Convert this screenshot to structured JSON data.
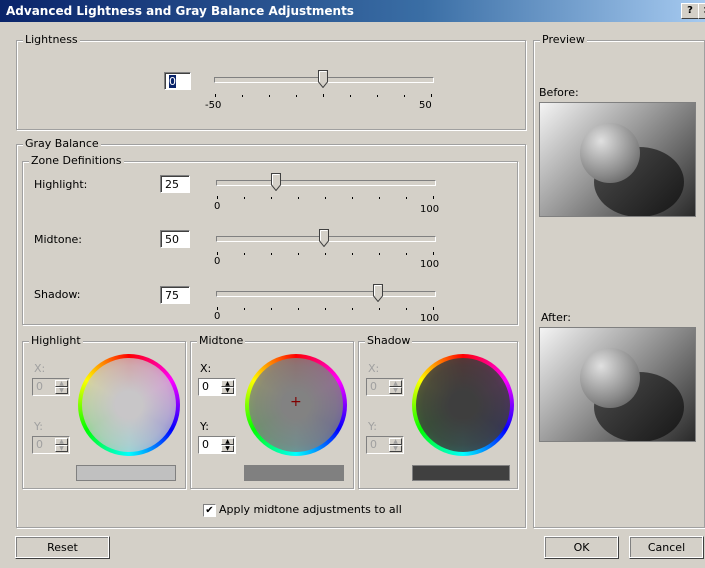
{
  "window": {
    "title": "Advanced Lightness and Gray Balance Adjustments",
    "help": "?",
    "close": "×"
  },
  "lightness": {
    "label": "Lightness",
    "value": "0",
    "slider_value": 0,
    "min_label": "-50",
    "max_label": "50"
  },
  "gray_balance": {
    "label": "Gray Balance",
    "zone_definitions": {
      "label": "Zone Definitions",
      "highlight": {
        "label": "Highlight:",
        "value": "25",
        "min_label": "0",
        "max_label": "100"
      },
      "midtone": {
        "label": "Midtone:",
        "value": "50",
        "min_label": "0",
        "max_label": "100"
      },
      "shadow": {
        "label": "Shadow:",
        "value": "75",
        "min_label": "0",
        "max_label": "100"
      }
    },
    "highlight_panel": {
      "label": "Highlight",
      "x_label": "X:",
      "x_value": "0",
      "y_label": "Y:",
      "y_value": "0",
      "swatch_color": "#c0c0c0"
    },
    "midtone_panel": {
      "label": "Midtone",
      "x_label": "X:",
      "x_value": "0",
      "y_label": "Y:",
      "y_value": "0",
      "swatch_color": "#808080",
      "crosshair": "+"
    },
    "shadow_panel": {
      "label": "Shadow",
      "x_label": "X:",
      "x_value": "0",
      "y_label": "Y:",
      "y_value": "0",
      "swatch_color": "#404040"
    },
    "apply_all": {
      "label": "Apply midtone adjustments to all",
      "checked": true
    }
  },
  "preview": {
    "label": "Preview",
    "before_label": "Before:",
    "after_label": "After:"
  },
  "buttons": {
    "reset": "Reset",
    "ok": "OK",
    "cancel": "Cancel"
  }
}
